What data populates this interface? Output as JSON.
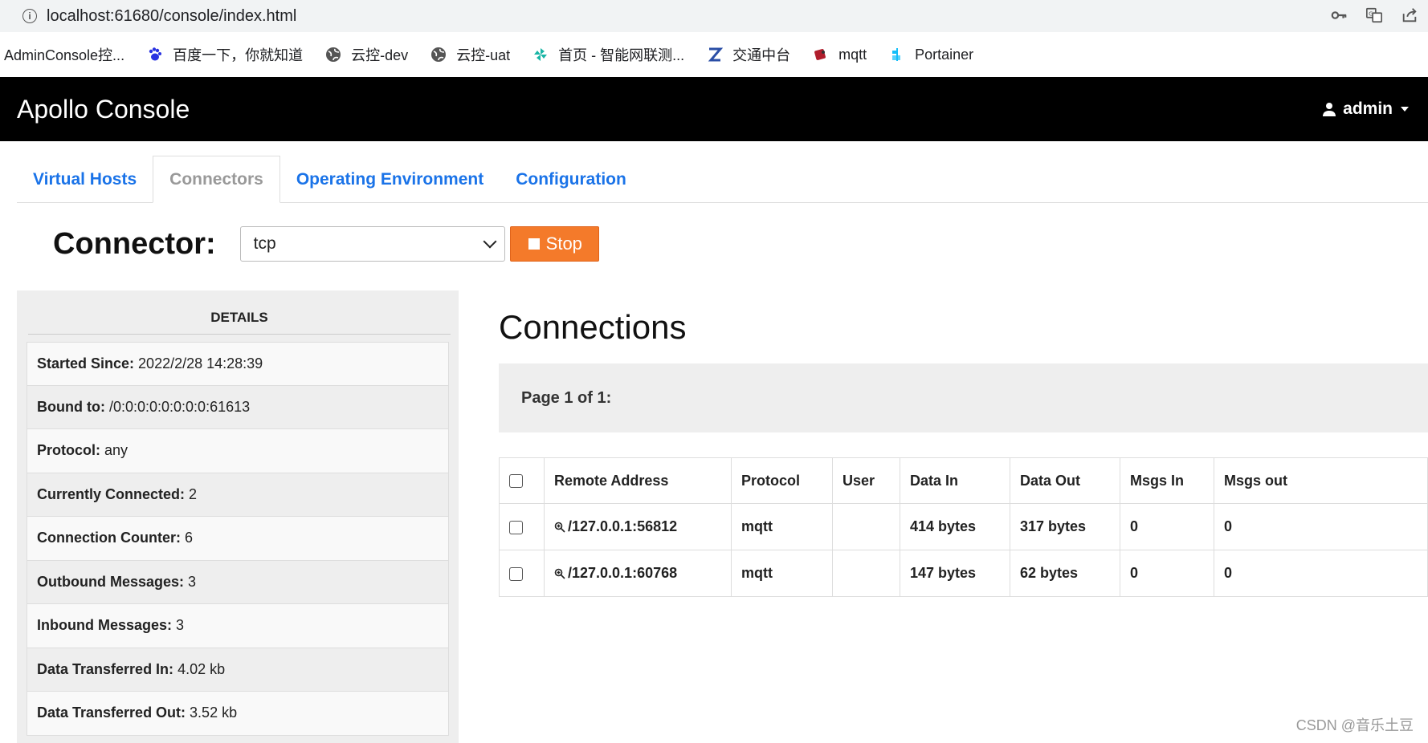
{
  "browser": {
    "url": "localhost:61680/console/index.html",
    "bookmarks": [
      {
        "label": "AdminConsole控...",
        "icon": "none"
      },
      {
        "label": "百度一下，你就知道",
        "icon": "baidu-paw-icon"
      },
      {
        "label": "云控-dev",
        "icon": "globe-icon"
      },
      {
        "label": "云控-uat",
        "icon": "globe-icon"
      },
      {
        "label": "首页 - 智能网联测...",
        "icon": "pinwheel-icon"
      },
      {
        "label": "交通中台",
        "icon": "z-logo-icon"
      },
      {
        "label": "mqtt",
        "icon": "mqtt-logo-icon"
      },
      {
        "label": "Portainer",
        "icon": "portainer-icon"
      }
    ]
  },
  "navbar": {
    "brand": "Apollo Console",
    "user": "admin"
  },
  "tabs": [
    {
      "label": "Virtual Hosts",
      "active": false
    },
    {
      "label": "Connectors",
      "active": true
    },
    {
      "label": "Operating Environment",
      "active": false
    },
    {
      "label": "Configuration",
      "active": false
    }
  ],
  "connector": {
    "label": "Connector:",
    "selected": "tcp",
    "stop_label": "Stop"
  },
  "details": {
    "title": "DETAILS",
    "rows": [
      {
        "key": "Started Since:",
        "value": "2022/2/28 14:28:39"
      },
      {
        "key": "Bound to:",
        "value": "/0:0:0:0:0:0:0:0:61613"
      },
      {
        "key": "Protocol:",
        "value": "any"
      },
      {
        "key": "Currently Connected:",
        "value": "2"
      },
      {
        "key": "Connection Counter:",
        "value": "6"
      },
      {
        "key": "Outbound Messages:",
        "value": "3"
      },
      {
        "key": "Inbound Messages:",
        "value": "3"
      },
      {
        "key": "Data Transferred In:",
        "value": "4.02 kb"
      },
      {
        "key": "Data Transferred Out:",
        "value": "3.52 kb"
      }
    ]
  },
  "connections": {
    "title": "Connections",
    "pager": "Page 1 of 1:",
    "columns": [
      "",
      "Remote Address",
      "Protocol",
      "User",
      "Data In",
      "Data Out",
      "Msgs In",
      "Msgs out"
    ],
    "rows": [
      {
        "address": "/127.0.0.1:56812",
        "protocol": "mqtt",
        "user": "",
        "data_in": "414 bytes",
        "data_out": "317 bytes",
        "msgs_in": "0",
        "msgs_out": "0"
      },
      {
        "address": "/127.0.0.1:60768",
        "protocol": "mqtt",
        "user": "",
        "data_in": "147 bytes",
        "data_out": "62 bytes",
        "msgs_in": "0",
        "msgs_out": "0"
      }
    ]
  },
  "watermark": "CSDN @音乐土豆",
  "colors": {
    "navbar_bg": "#000000",
    "tab_link": "#1a73e8",
    "stop_button": "#f47a2a",
    "panel_bg": "#eeeeee"
  }
}
